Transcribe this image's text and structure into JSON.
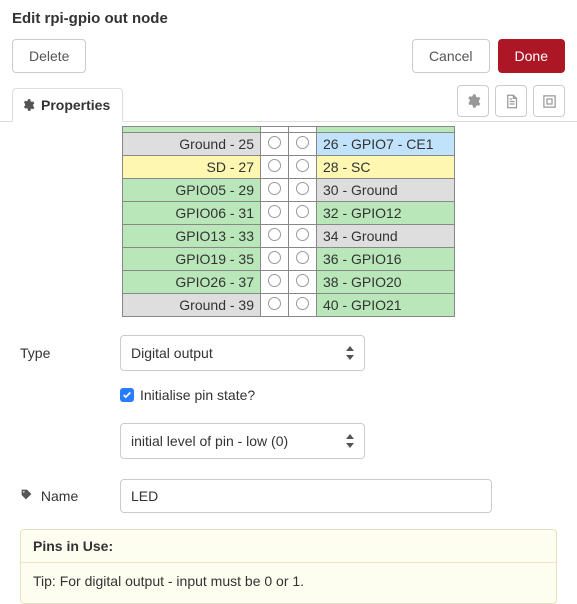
{
  "header": {
    "title": "Edit rpi-gpio out node"
  },
  "buttons": {
    "delete": "Delete",
    "cancel": "Cancel",
    "done": "Done"
  },
  "tabs": {
    "properties": "Properties"
  },
  "pins": [
    {
      "left": {
        "label": "",
        "cls": "green"
      },
      "right": {
        "label": "",
        "cls": "green"
      }
    },
    {
      "left": {
        "label": "Ground - 25",
        "cls": "grey"
      },
      "right": {
        "label": "26 - GPIO7 - CE1",
        "cls": "blue"
      }
    },
    {
      "left": {
        "label": "SD - 27",
        "cls": "yellow"
      },
      "right": {
        "label": "28 - SC",
        "cls": "yellow"
      }
    },
    {
      "left": {
        "label": "GPIO05 - 29",
        "cls": "green"
      },
      "right": {
        "label": "30 - Ground",
        "cls": "grey"
      }
    },
    {
      "left": {
        "label": "GPIO06 - 31",
        "cls": "green"
      },
      "right": {
        "label": "32 - GPIO12",
        "cls": "green"
      }
    },
    {
      "left": {
        "label": "GPIO13 - 33",
        "cls": "green"
      },
      "right": {
        "label": "34 - Ground",
        "cls": "grey"
      }
    },
    {
      "left": {
        "label": "GPIO19 - 35",
        "cls": "green"
      },
      "right": {
        "label": "36 - GPIO16",
        "cls": "green"
      }
    },
    {
      "left": {
        "label": "GPIO26 - 37",
        "cls": "green"
      },
      "right": {
        "label": "38 - GPIO20",
        "cls": "green"
      }
    },
    {
      "left": {
        "label": "Ground - 39",
        "cls": "grey"
      },
      "right": {
        "label": "40 - GPIO21",
        "cls": "green"
      }
    }
  ],
  "form": {
    "type_label": "Type",
    "type_value": "Digital output",
    "init_label": "Initialise pin state?",
    "init_level_value": "initial level of pin - low (0)",
    "name_label": "Name",
    "name_value": "LED"
  },
  "note": {
    "head": "Pins in Use",
    "body": "Tip: For digital output - input must be 0 or 1."
  }
}
